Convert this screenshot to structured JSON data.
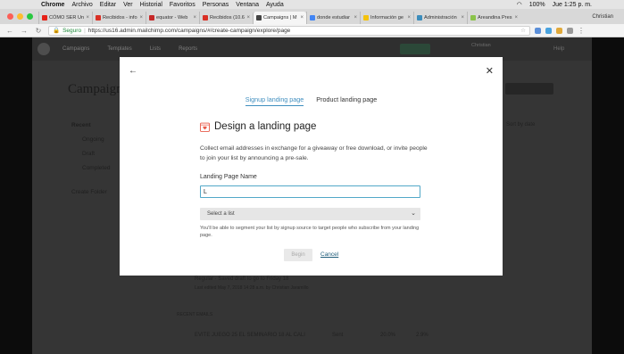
{
  "menubar": {
    "app_name": "Chrome",
    "items": [
      "Archivo",
      "Editar",
      "Ver",
      "Historial",
      "Favoritos",
      "Personas",
      "Ventana",
      "Ayuda"
    ],
    "battery": "100%",
    "clock": "Jue 1:25 p. m."
  },
  "tabs": [
    {
      "label": "CÓMO SER Un",
      "color": "#e62117"
    },
    {
      "label": "Recibidos - info",
      "color": "#d93025"
    },
    {
      "label": "equator - Web",
      "color": "#c62828"
    },
    {
      "label": "Recibidos (10.6",
      "color": "#d93025"
    },
    {
      "label": "Campaigns | M",
      "color": "#444444",
      "active": true
    },
    {
      "label": "donde estudiar",
      "color": "#4285f4"
    },
    {
      "label": "Información ge",
      "color": "#f4c20d"
    },
    {
      "label": "Administración",
      "color": "#3c8dbc"
    },
    {
      "label": "Areandina Pres",
      "color": "#8bc34a"
    }
  ],
  "profile_name": "Christian",
  "address": {
    "secure_label": "Seguro",
    "url": "https://us16.admin.mailchimp.com/campaigns/#/create-campaign/explore/page"
  },
  "app": {
    "nav_items": [
      "Campaigns",
      "Templates",
      "Lists",
      "Reports"
    ],
    "page_title": "Campaigns",
    "sidebar": [
      "Recent",
      "Ongoing",
      "Draft",
      "Completed",
      "Create Folder"
    ],
    "rows": [
      "Regular · Saved draft to go to Friday 18",
      "Last edited May 7, 2018 14:28 a.m. by Christian Jaramillo",
      "RECENT EMAILS",
      "EVITE JUEGO 25 EL SEMINARIO 18 AL CALI",
      "Sent",
      "20.0%",
      "2.9%",
      "Sort by date"
    ]
  },
  "modal": {
    "back_icon": "arrow-left-icon",
    "close_icon": "close-icon",
    "tabs": [
      "Signup landing page",
      "Product landing page"
    ],
    "active_tab": 0,
    "title": "Design a landing page",
    "description": "Collect email addresses in exchange for a giveaway or free download, or invite people to join your list by announcing a pre-sale.",
    "field_label": "Landing Page Name",
    "field_value": "L",
    "select_placeholder": "Select a list",
    "hint": "You'll be able to segment your list by signup source to target people who subscribe from your landing page.",
    "begin_label": "Begin",
    "cancel_label": "Cancel",
    "accent_color": "#3f8ebf"
  }
}
